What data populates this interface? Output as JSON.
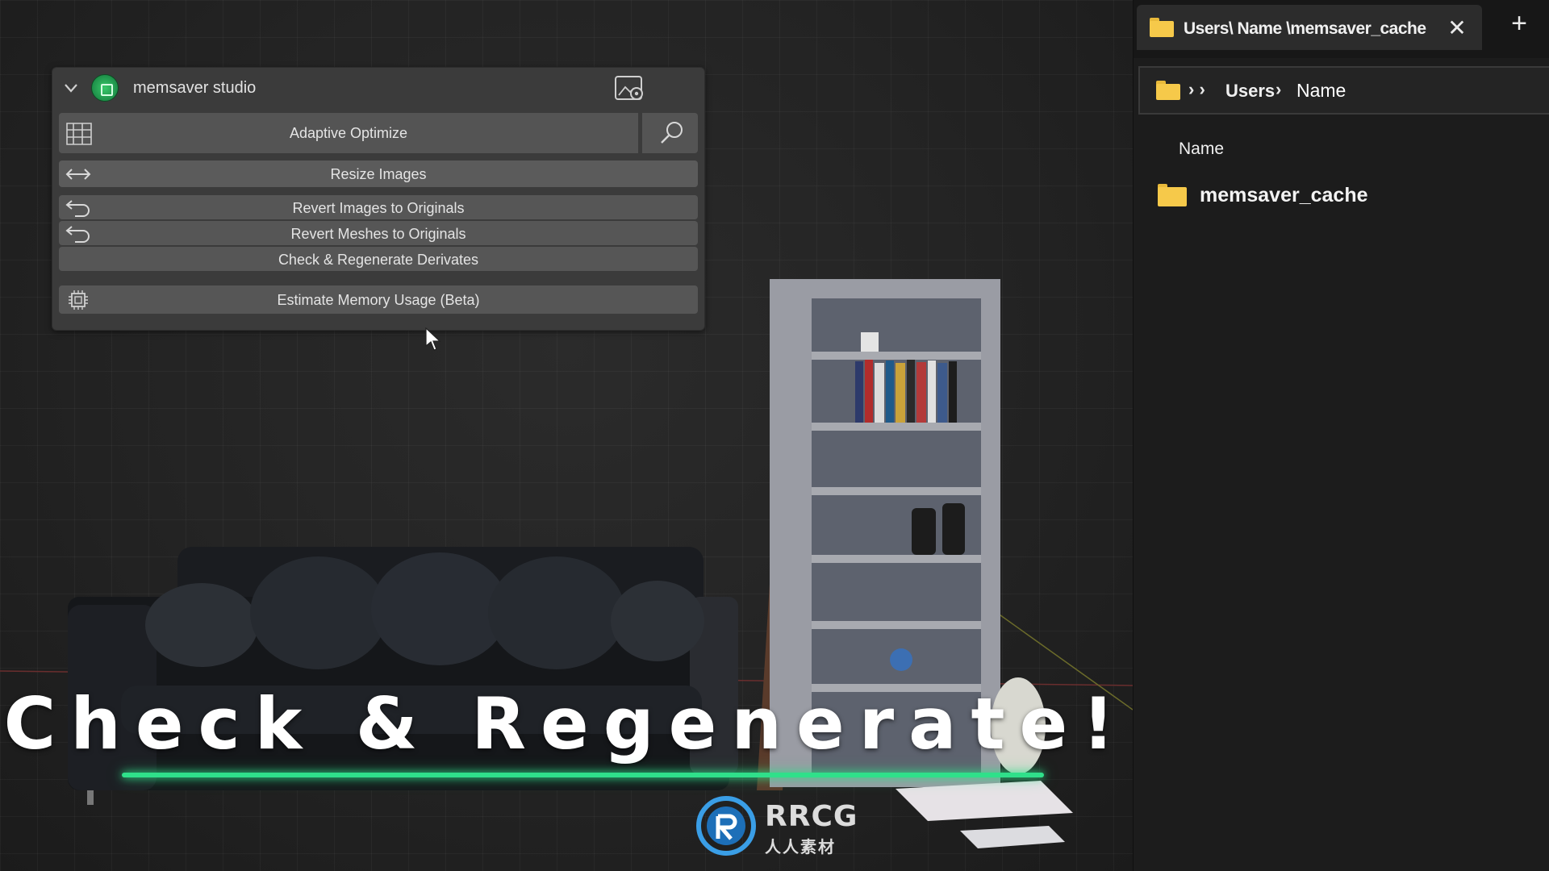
{
  "panel": {
    "title": "memsaver studio",
    "buttons": {
      "adaptive_optimize": "Adaptive Optimize",
      "resize_images": "Resize Images",
      "revert_images": "Revert Images to Originals",
      "revert_meshes": "Revert Meshes to Originals",
      "check_regenerate": "Check & Regenerate Derivates",
      "estimate_memory": "Estimate Memory Usage (Beta)"
    },
    "icons": {
      "collapse": "chevron-down-icon",
      "logo": "memsaver-logo-icon",
      "settings": "settings-image-icon",
      "grid": "grid-icon",
      "search": "search-icon",
      "resize": "resize-arrows-icon",
      "revert": "undo-arrow-icon",
      "chip": "chip-icon"
    },
    "accent_color": "#2fe08a"
  },
  "explorer": {
    "tab_title": "Users\\ Name \\memsaver_cache",
    "tab_close": "✕",
    "tab_new": "+",
    "address": {
      "overflow": "› ›",
      "separator": "›",
      "segments": [
        "Users",
        "Name"
      ]
    },
    "column_header": "Name",
    "items": [
      {
        "name": "memsaver_cache",
        "type": "folder"
      }
    ],
    "folder_color": "#f6c94a"
  },
  "overlay": {
    "caption": "Check & Regenerate!",
    "watermark": {
      "logo_text": "RRCG",
      "sub_text": "人人素材"
    }
  }
}
